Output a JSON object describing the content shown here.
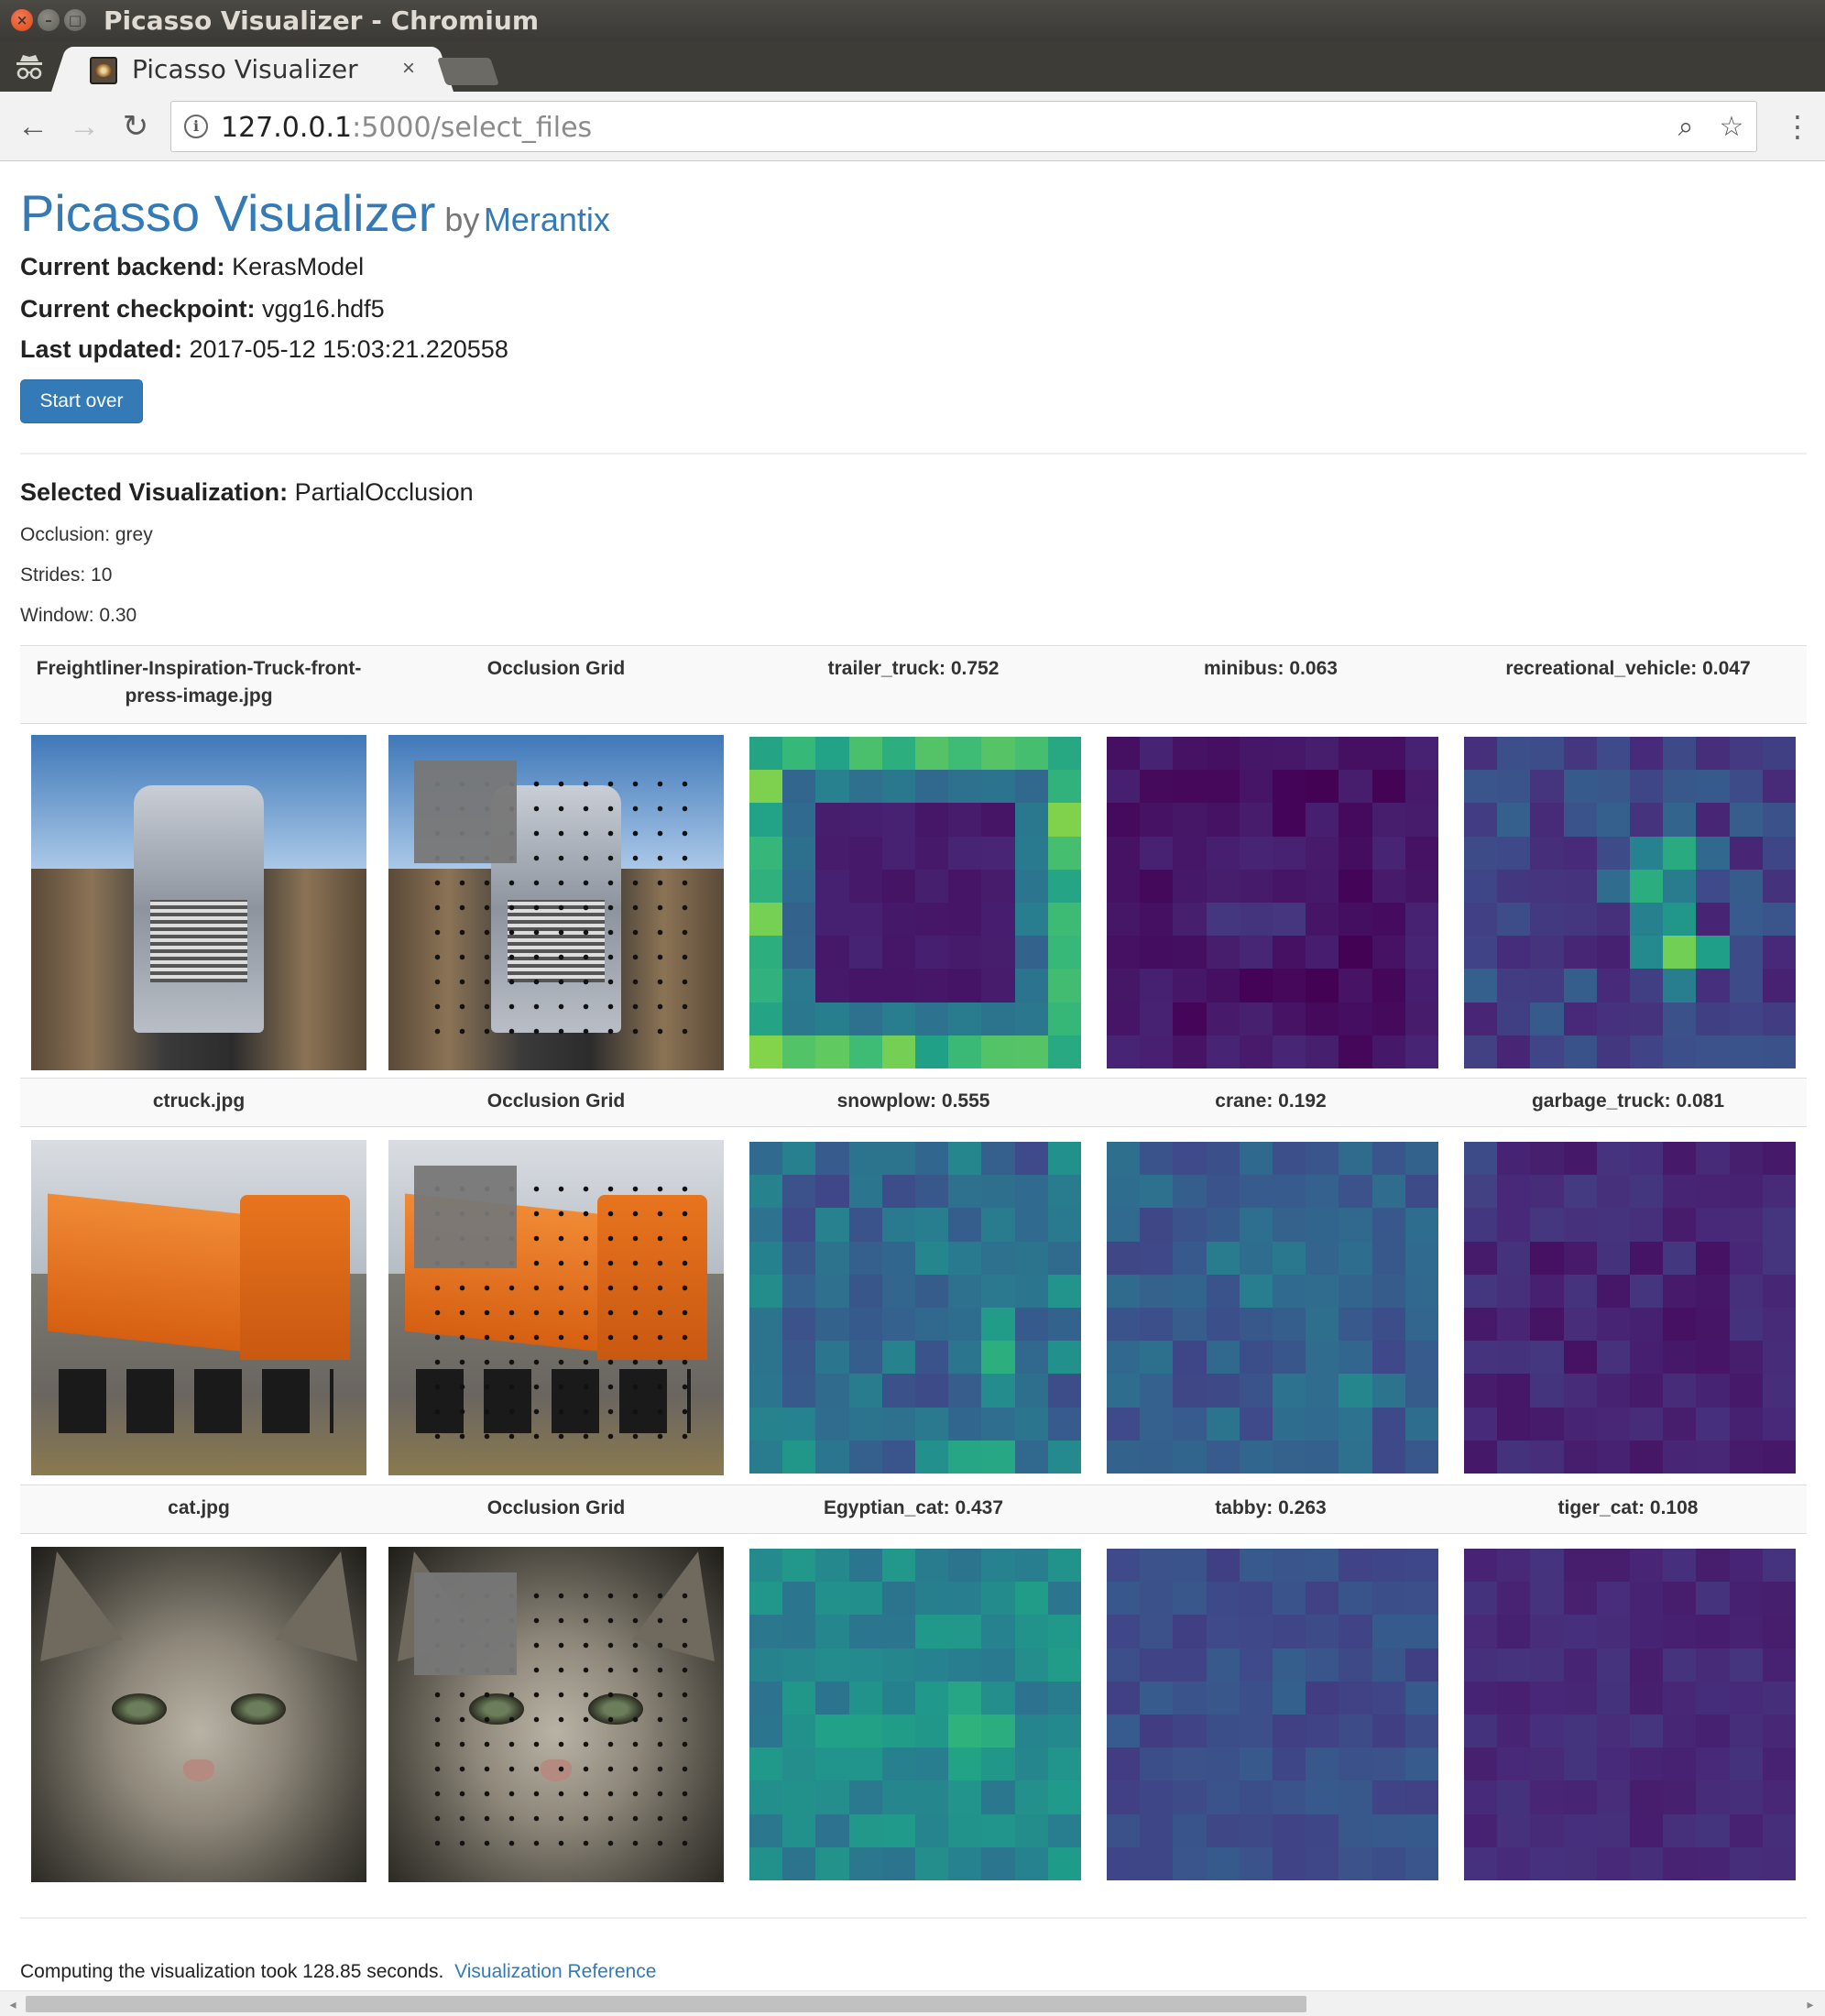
{
  "window": {
    "title": "Picasso Visualizer - Chromium",
    "tab_title": "Picasso Visualizer",
    "tab_close": "×",
    "url_host": "127.0.0.1",
    "url_rest": ":5000/select_files"
  },
  "header": {
    "app_name": "Picasso Visualizer",
    "by": "by",
    "org": "Merantix"
  },
  "info": {
    "backend_label": "Current backend:",
    "backend_value": "KerasModel",
    "checkpoint_label": "Current checkpoint:",
    "checkpoint_value": "vgg16.hdf5",
    "updated_label": "Last updated:",
    "updated_value": "2017-05-12 15:03:21.220558",
    "start_over": "Start over"
  },
  "visualization": {
    "label": "Selected Visualization:",
    "value": "PartialOcclusion",
    "occlusion": "Occlusion: grey",
    "strides": "Strides: 10",
    "window": "Window: 0.30"
  },
  "results": [
    {
      "file": "Freightliner-Inspiration-Truck-front-press-image.jpg",
      "grid_label": "Occlusion Grid",
      "predictions": [
        "trailer_truck: 0.752",
        "minibus: 0.063",
        "recreational_vehicle: 0.047"
      ]
    },
    {
      "file": "ctruck.jpg",
      "grid_label": "Occlusion Grid",
      "predictions": [
        "snowplow: 0.555",
        "crane: 0.192",
        "garbage_truck: 0.081"
      ]
    },
    {
      "file": "cat.jpg",
      "grid_label": "Occlusion Grid",
      "predictions": [
        "Egyptian_cat: 0.437",
        "tabby: 0.263",
        "tiger_cat: 0.108"
      ]
    }
  ],
  "footer": {
    "text": "Computing the visualization took 128.85 seconds.",
    "link": "Visualization Reference"
  },
  "colors": {
    "link": "#337ab7",
    "button": "#337ab7",
    "heatmap_low": "#440154",
    "heatmap_high": "#b5de2b"
  },
  "icons": {
    "back": "←",
    "forward": "→",
    "reload": "↻",
    "info": "i",
    "zoom": "⌕",
    "star": "☆",
    "menu": "⋮"
  }
}
